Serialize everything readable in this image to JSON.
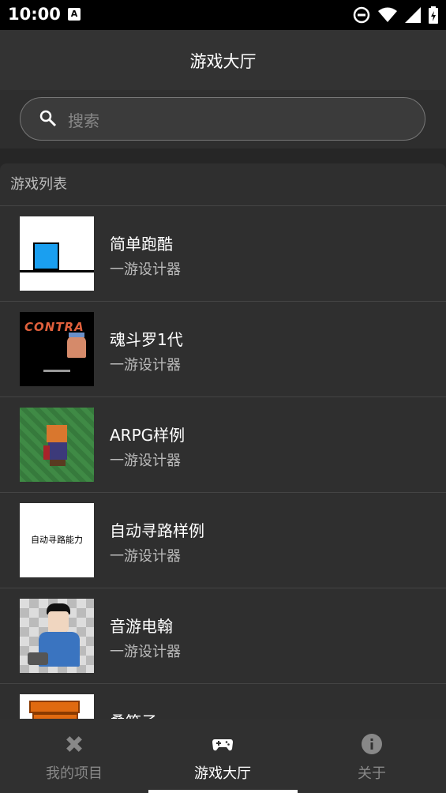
{
  "status": {
    "time": "10:00",
    "a_icon_letter": "A"
  },
  "appbar": {
    "title": "游戏大厅"
  },
  "search": {
    "placeholder": "搜索"
  },
  "list": {
    "header": "游戏列表",
    "items": [
      {
        "name": "简单跑酷",
        "sub": "一游设计器"
      },
      {
        "name": "魂斗罗1代",
        "sub": "一游设计器",
        "thumb_logo": "CONTRA"
      },
      {
        "name": "ARPG样例",
        "sub": "一游设计器"
      },
      {
        "name": "自动寻路样例",
        "sub": "一游设计器",
        "thumb_text": "自动寻路能力"
      },
      {
        "name": "音游电翰",
        "sub": "一游设计器"
      },
      {
        "name": "叠箱子",
        "sub": ""
      }
    ]
  },
  "nav": {
    "items": [
      {
        "label": "我的项目",
        "icon": "pencil-ruler-icon"
      },
      {
        "label": "游戏大厅",
        "icon": "gamepad-icon"
      },
      {
        "label": "关于",
        "icon": "info-icon"
      }
    ],
    "active_index": 1
  },
  "colors": {
    "accent_blue": "#1a9ff0",
    "background": "#262626"
  }
}
